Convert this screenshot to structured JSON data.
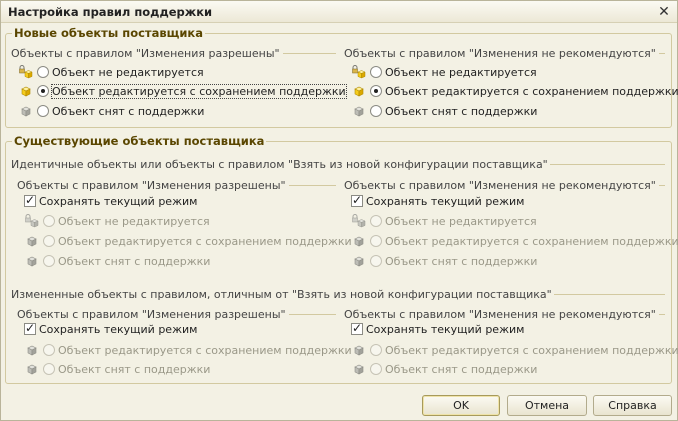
{
  "window": {
    "title": "Настройка правил поддержки",
    "close_glyph": "✕"
  },
  "colors": {
    "background": "#f3f1e4",
    "group_title": "#5a4600",
    "frame": "#d2c9a0"
  },
  "icons": {
    "locked": "lock-cube-icon",
    "editable": "yellow-cube-icon",
    "removed": "gray-cube-icon"
  },
  "new_objects": {
    "title": "Новые объекты поставщика",
    "allowed": {
      "caption": "Объекты с правилом \"Изменения разрешены\"",
      "options": [
        {
          "label": "Объект не редактируется",
          "icon": "lock-cube-icon",
          "selected": false
        },
        {
          "label": "Объект редактируется с сохранением поддержки",
          "icon": "yellow-cube-icon",
          "selected": true
        },
        {
          "label": "Объект снят с поддержки",
          "icon": "gray-cube-icon",
          "selected": false
        }
      ]
    },
    "not_recommended": {
      "caption": "Объекты с правилом \"Изменения не рекомендуются\"",
      "options": [
        {
          "label": "Объект не редактируется",
          "icon": "lock-cube-icon",
          "selected": false
        },
        {
          "label": "Объект редактируется с сохранением поддержки",
          "icon": "yellow-cube-icon",
          "selected": true
        },
        {
          "label": "Объект снят с поддержки",
          "icon": "gray-cube-icon",
          "selected": false
        }
      ]
    }
  },
  "existing_objects": {
    "title": "Существующие объекты поставщика",
    "identical": {
      "caption": "Идентичные объекты или объекты с правилом \"Взять из новой конфигурации поставщика\"",
      "allowed": {
        "caption": "Объекты с правилом \"Изменения разрешены\"",
        "keep_mode": {
          "label": "Сохранять текущий режим",
          "checked": true
        },
        "options": [
          {
            "label": "Объект не редактируется",
            "icon": "lock-cube-icon",
            "enabled": false
          },
          {
            "label": "Объект редактируется с сохранением поддержки",
            "icon": "yellow-cube-icon",
            "enabled": false
          },
          {
            "label": "Объект снят с поддержки",
            "icon": "gray-cube-icon",
            "enabled": false
          }
        ]
      },
      "not_recommended": {
        "caption": "Объекты с правилом \"Изменения не рекомендуются\"",
        "keep_mode": {
          "label": "Сохранять текущий режим",
          "checked": true
        },
        "options": [
          {
            "label": "Объект не редактируется",
            "icon": "lock-cube-icon",
            "enabled": false
          },
          {
            "label": "Объект редактируется с сохранением поддержки",
            "icon": "yellow-cube-icon",
            "enabled": false
          },
          {
            "label": "Объект снят с поддержки",
            "icon": "gray-cube-icon",
            "enabled": false
          }
        ]
      }
    },
    "changed": {
      "caption": "Измененные объекты с правилом, отличным от \"Взять из новой конфигурации поставщика\"",
      "allowed": {
        "caption": "Объекты с правилом \"Изменения разрешены\"",
        "keep_mode": {
          "label": "Сохранять текущий режим",
          "checked": true
        },
        "options": [
          {
            "label": "Объект редактируется с сохранением поддержки",
            "icon": "yellow-cube-icon",
            "enabled": false
          },
          {
            "label": "Объект снят с поддержки",
            "icon": "gray-cube-icon",
            "enabled": false
          }
        ]
      },
      "not_recommended": {
        "caption": "Объекты с правилом \"Изменения не рекомендуются\"",
        "keep_mode": {
          "label": "Сохранять текущий режим",
          "checked": true
        },
        "options": [
          {
            "label": "Объект редактируется с сохранением поддержки",
            "icon": "yellow-cube-icon",
            "enabled": false
          },
          {
            "label": "Объект снят с поддержки",
            "icon": "gray-cube-icon",
            "enabled": false
          }
        ]
      }
    }
  },
  "buttons": {
    "ok": "OK",
    "cancel": "Отмена",
    "help": "Справка"
  }
}
